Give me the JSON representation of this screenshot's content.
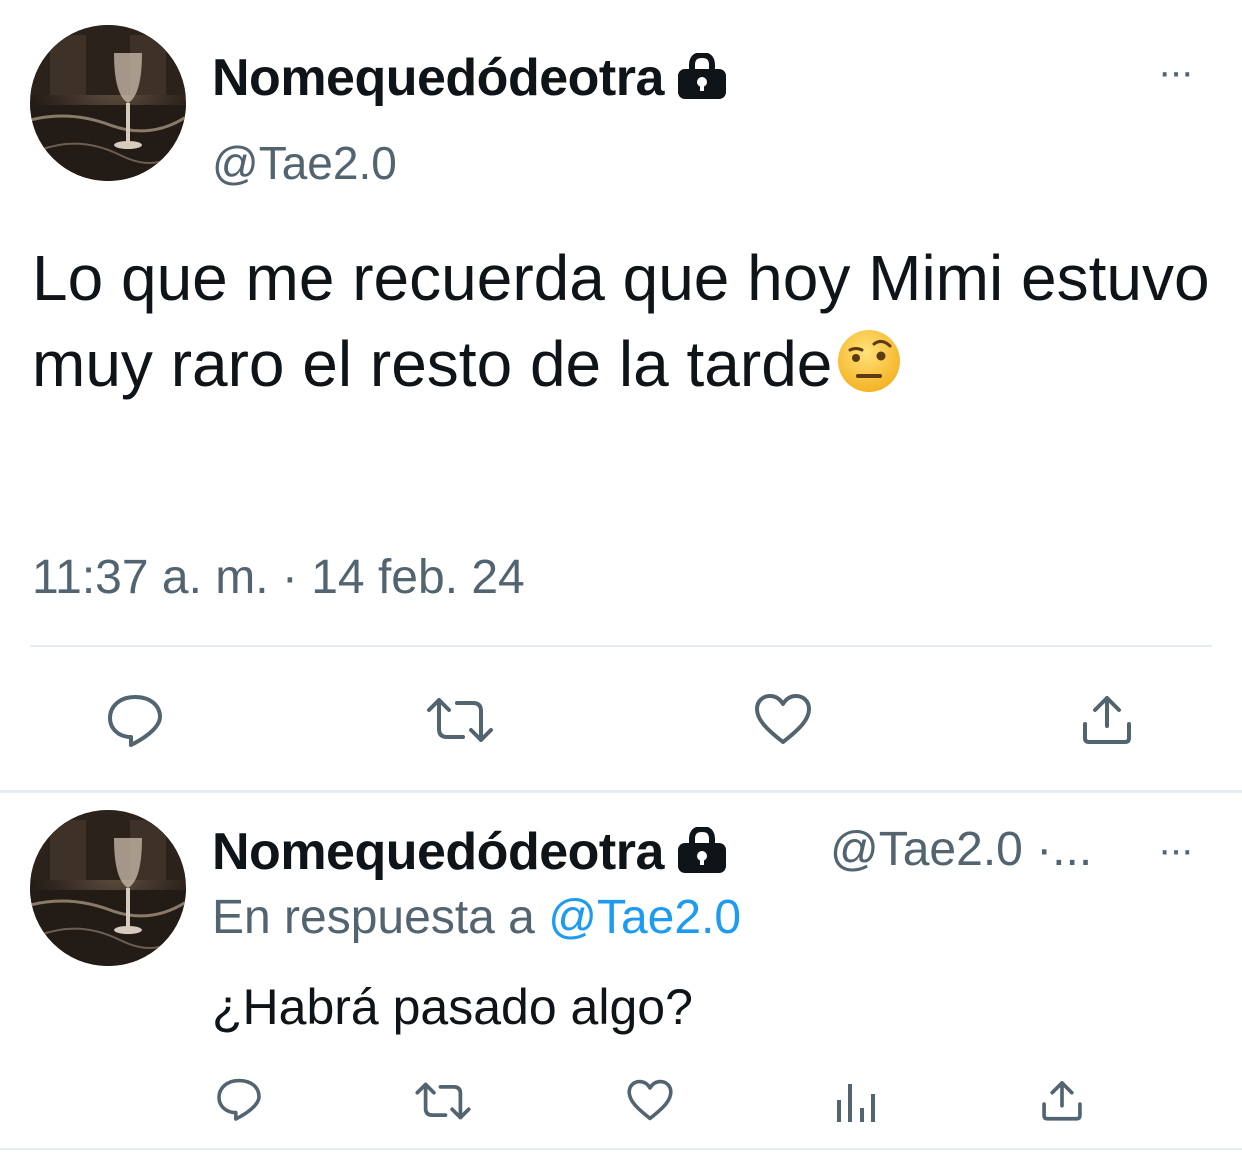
{
  "main_tweet": {
    "author": {
      "display_name": "Nomequedódeotra",
      "handle": "@Tae2.0",
      "protected_icon": "lock-icon"
    },
    "more_label": "···",
    "text": "Lo que me recuerda que hoy Mimi estuvo muy raro el resto de la tarde",
    "emoji": "face-with-raised-eyebrow",
    "timestamp": "11:37 a. m. · 14 feb. 24",
    "actions": [
      "reply-icon",
      "retweet-icon",
      "like-icon",
      "share-icon"
    ]
  },
  "reply_tweet": {
    "author": {
      "display_name": "Nomequedódeotra",
      "handle": "@Tae2.0",
      "separator": "·..."
    },
    "more_label": "···",
    "reply_prefix": "En respuesta a",
    "reply_to": "@Tae2.0",
    "text": "¿Habrá pasado algo?",
    "actions": [
      "reply-icon",
      "retweet-icon",
      "like-icon",
      "views-icon",
      "share-icon"
    ]
  },
  "colors": {
    "text": "#0f1419",
    "secondary": "#536471",
    "link": "#1d9bf0",
    "divider": "#e6ecf0"
  }
}
